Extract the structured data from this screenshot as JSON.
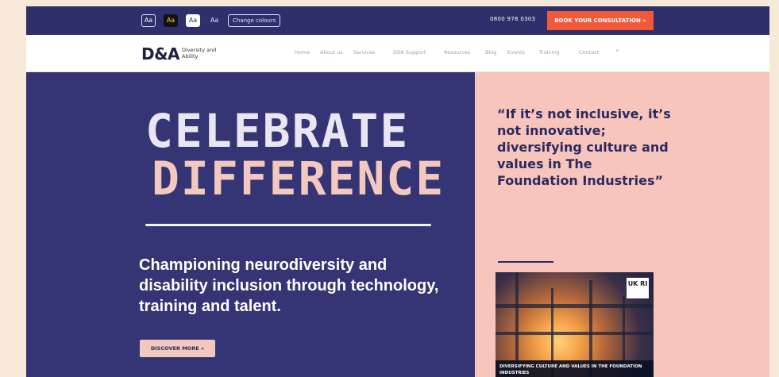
{
  "accessibility": {
    "buttons": [
      "Aa",
      "Aa",
      "Aa",
      "Aa"
    ],
    "change_colours": "Change colours"
  },
  "header": {
    "phone": "0800 978 0303",
    "cta": "Book your consultation »"
  },
  "nav": {
    "logo": "D&A",
    "logo_sub": "Diversity and Ability",
    "items": [
      "Home",
      "About us",
      "Services",
      "DSA Support",
      "Resources",
      "Blog",
      "Events",
      "Training",
      "Contact"
    ]
  },
  "hero": {
    "headline_line1": "CELEBRATE",
    "headline_line2": "DIFFERENCE",
    "tagline": "Championing neurodiversity and disability inclusion through technology, training and talent.",
    "discover": "DISCOVER MORE »"
  },
  "side": {
    "quote": "“If it’s not inclusive, it’s not innovative; diversifying culture and values in The Foundation Industries”",
    "promo_badge": "UK RI",
    "promo_caption": "DIVERSIFYING CULTURE AND VALUES IN THE FOUNDATION INDUSTRIES"
  },
  "colors": {
    "top_bar": "#2f2f6b",
    "hero_bg": "#353575",
    "accent": "#f05a3a",
    "side_bg": "#f8c5bd"
  }
}
